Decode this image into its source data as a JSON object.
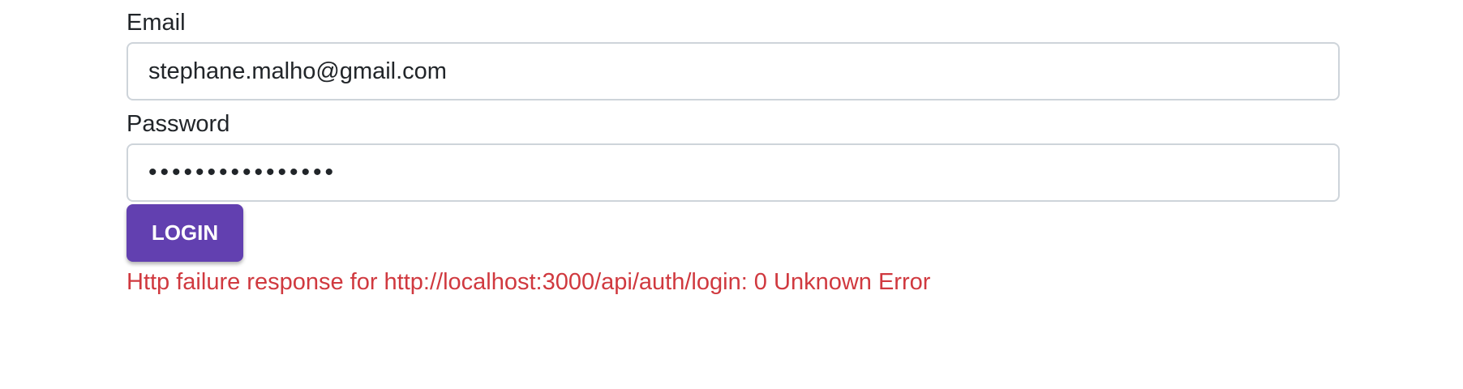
{
  "form": {
    "email_label": "Email",
    "email_value": "stephane.malho@gmail.com",
    "password_label": "Password",
    "password_value": "••••••••••••••••",
    "login_label": "LOGIN",
    "error_message": "Http failure response for http://localhost:3000/api/auth/login: 0 Unknown Error"
  },
  "colors": {
    "button": "#6240b0",
    "error": "#d0393f"
  }
}
